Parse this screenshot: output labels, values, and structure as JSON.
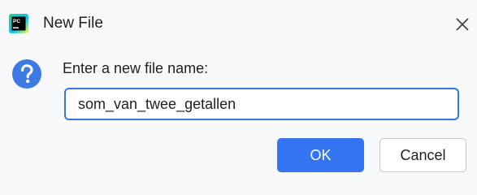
{
  "window": {
    "title": "New File",
    "app_icon": "pycharm-icon",
    "app_icon_text": "PC",
    "close_icon": "close-icon"
  },
  "dialog": {
    "icon": "question-icon",
    "prompt": "Enter a new file name:",
    "input_value": "som_van_twee_getallen"
  },
  "buttons": {
    "ok_label": "OK",
    "cancel_label": "Cancel"
  },
  "colors": {
    "accent": "#3574f0",
    "background": "#f7f8fa",
    "question_icon": "#3d7ae3"
  }
}
